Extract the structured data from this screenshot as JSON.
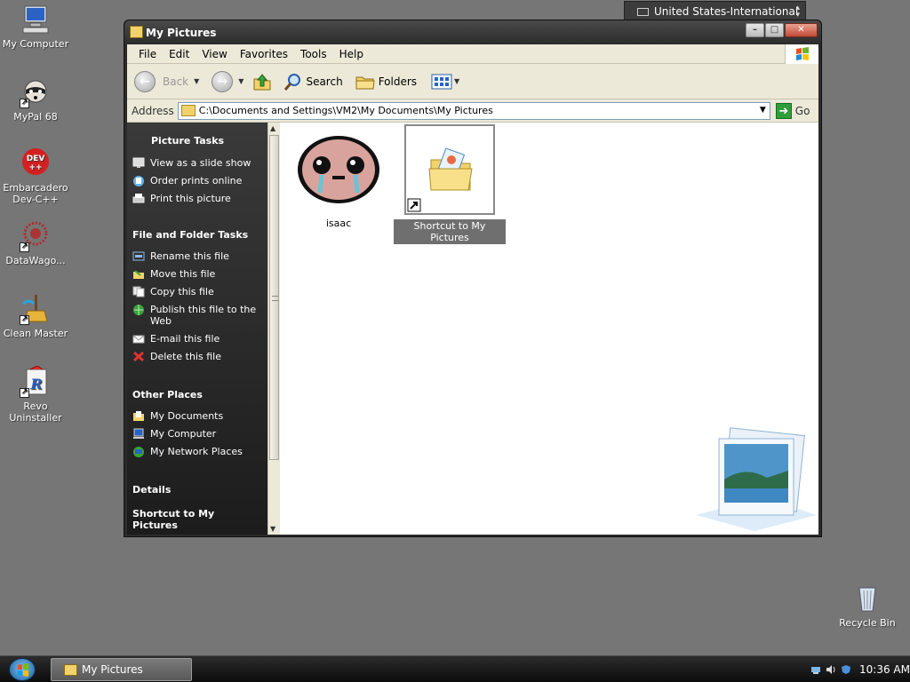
{
  "desktop": {
    "icons": [
      {
        "label": "My Computer",
        "icon": "my-computer-icon"
      },
      {
        "label": "MyPal 68",
        "icon": "mypal-raccoon-icon"
      },
      {
        "label": "Embarcadero Dev-C++",
        "icon": "devcpp-icon"
      },
      {
        "label": "DataWago...",
        "icon": "datawago-icon"
      },
      {
        "label": "Clean Master",
        "icon": "clean-master-icon"
      },
      {
        "label": "Revo Uninstaller",
        "icon": "revo-uninstaller-icon"
      },
      {
        "label": "Recycle Bin",
        "icon": "recycle-bin-icon"
      }
    ],
    "devcpp_badge": "DEV\n++"
  },
  "language_bar": {
    "label": "United States-International"
  },
  "window": {
    "title": "My Pictures",
    "controls": {
      "minimize": "–",
      "maximize": "□",
      "close": "✕"
    },
    "menu": [
      "File",
      "Edit",
      "View",
      "Favorites",
      "Tools",
      "Help"
    ],
    "toolbar": {
      "back": "Back",
      "search": "Search",
      "folders": "Folders"
    },
    "address": {
      "label": "Address",
      "value": "C:\\Documents and Settings\\VM2\\My Documents\\My Pictures",
      "go": "Go"
    },
    "task_pane": {
      "picture_tasks": {
        "title": "Picture Tasks",
        "items": [
          "View as a slide show",
          "Order prints online",
          "Print this picture"
        ]
      },
      "file_folder_tasks": {
        "title": "File and Folder Tasks",
        "items": [
          "Rename this file",
          "Move this file",
          "Copy this file",
          "Publish this file to the Web",
          "E-mail this file",
          "Delete this file"
        ]
      },
      "other_places": {
        "title": "Other Places",
        "items": [
          "My Documents",
          "My Computer",
          "My Network Places"
        ]
      },
      "details": {
        "title": "Details",
        "name": "Shortcut to My Pictures"
      }
    },
    "files": [
      {
        "name": "isaac",
        "icon": "isaac-thumbnail-icon",
        "selected": false
      },
      {
        "name": "Shortcut to My Pictures",
        "icon": "pictures-folder-shortcut-icon",
        "selected": true
      }
    ]
  },
  "taskbar": {
    "task": "My Pictures",
    "clock": "10:36 AM"
  }
}
